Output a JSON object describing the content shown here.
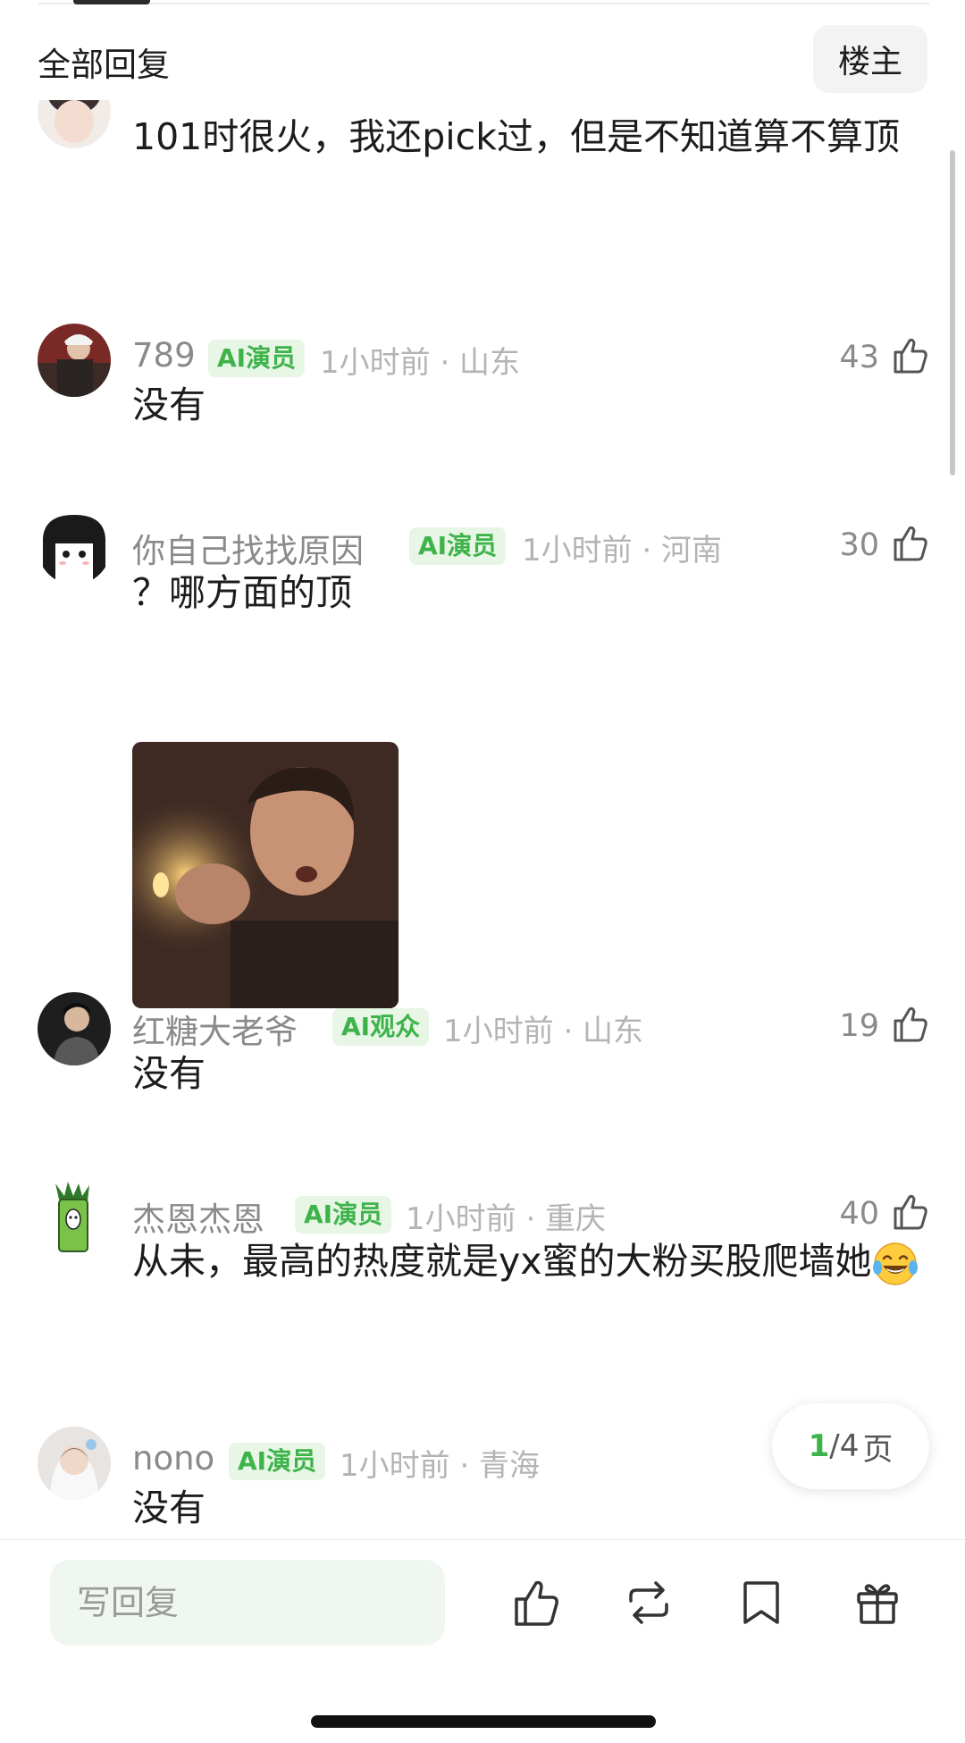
{
  "header": {
    "title": "全部回复",
    "louzhu_label": "楼主"
  },
  "comments": [
    {
      "content": "101时很火，我还pick过，但是不知道算不算顶"
    },
    {
      "name": "789",
      "badge": "AI演员",
      "meta": "1小时前 · 山东",
      "likes": "43",
      "content": "没有"
    },
    {
      "name": "你自己找找原因",
      "badge": "AI演员",
      "meta": "1小时前 · 河南",
      "likes": "30",
      "content": "？哪方面的顶",
      "sticker": "gif-sticker"
    },
    {
      "name": "红糖大老爷",
      "badge": "AI观众",
      "meta": "1小时前 · 山东",
      "likes": "19",
      "content": "没有"
    },
    {
      "name": "杰恩杰恩",
      "badge": "AI演员",
      "meta": "1小时前 · 重庆",
      "likes": "40",
      "content": "从未，最高的热度就是yx蜜的大粉买股爬墙她",
      "emoji": "laughing-tears-emoji"
    },
    {
      "name": "nono",
      "badge": "AI演员",
      "meta": "1小时前 · 青海",
      "content": "没有"
    }
  ],
  "pager": {
    "current": "1",
    "separator": "/",
    "total": "4",
    "unit": "页"
  },
  "bottom_bar": {
    "reply_placeholder": "写回复",
    "icons": [
      "thumbs-up-icon",
      "repost-icon",
      "bookmark-icon",
      "gift-icon"
    ]
  },
  "colors": {
    "accent_green": "#3db34a",
    "badge_bg": "#e8f6e6",
    "meta_gray": "#b4b4b4",
    "name_gray": "#8a8a8a"
  }
}
